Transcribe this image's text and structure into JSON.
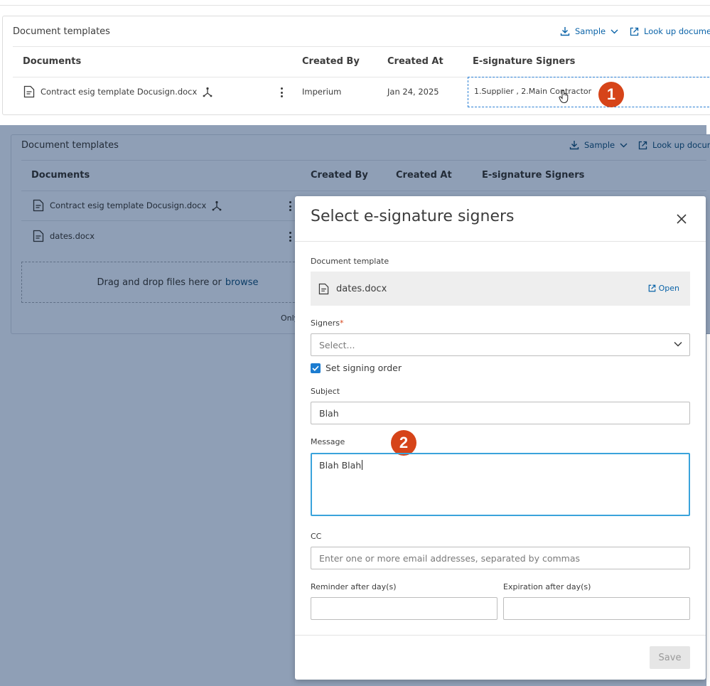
{
  "top_panel": {
    "title": "Document templates",
    "sample_label": "Sample",
    "lookup_label": "Look up document",
    "columns": [
      "Documents",
      "Created By",
      "Created At",
      "E-signature Signers"
    ],
    "row": {
      "name": "Contract esig template Docusign.docx",
      "created_by": "Imperium",
      "created_at": "Jan 24, 2025",
      "signers": "1.Supplier , 2.Main Contractor"
    },
    "step_badge": "1"
  },
  "background_panel": {
    "title": "Document templates",
    "sample_label": "Sample",
    "lookup_label": "Look up docum",
    "columns": [
      "Documents",
      "Created By",
      "Created At",
      "E-signature Signers"
    ],
    "rows": [
      {
        "name": "Contract esig template Docusign.docx"
      },
      {
        "name": "dates.docx"
      }
    ],
    "drop_text": "Drag and drop files here or",
    "browse_label": "browse",
    "note_fragment": "Only"
  },
  "modal": {
    "title": "Select e-signature signers",
    "document_template_label": "Document template",
    "document_name": "dates.docx",
    "open_label": "Open",
    "signers_label": "Signers",
    "required_mark": "*",
    "signers_placeholder": "Select...",
    "signing_order_label": "Set signing order",
    "signing_order_checked": true,
    "subject_label": "Subject",
    "subject_value": "Blah",
    "message_label": "Message",
    "message_value": "Blah Blah",
    "cc_label": "CC",
    "cc_placeholder": "Enter one or more email addresses, separated by commas",
    "reminder_label": "Reminder after day(s)",
    "expiration_label": "Expiration after day(s)",
    "save_label": "Save",
    "step_badge": "2"
  },
  "colors": {
    "link": "#0a63a8",
    "badge": "#d64419",
    "overlay": "#8f9fb6",
    "focus": "#3aa3db",
    "checkbox": "#1c7cd0"
  }
}
